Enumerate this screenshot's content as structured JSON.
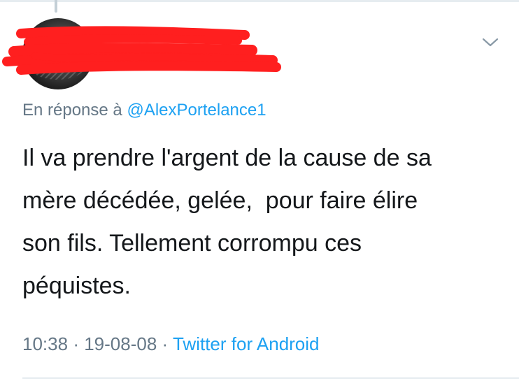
{
  "reply_to": {
    "prefix": "En réponse à",
    "handle": "@AlexPortelance1"
  },
  "tweet": {
    "text": "Il va prendre l'argent de la cause de sa\nmère décédée, gelée,  pour faire élire\nson fils. Tellement corrompu ces\npéquistes."
  },
  "meta": {
    "time": "10:38",
    "separator_1": "·",
    "date": "19-08-08",
    "separator_2": "·",
    "source": "Twitter for Android"
  },
  "colors": {
    "link": "#1da1f2",
    "secondary_text": "#657786",
    "primary_text": "#14171a",
    "redaction": "#ff1f1f",
    "border": "#e6ecf0"
  },
  "icons": {
    "menu": "chevron-down-icon"
  }
}
